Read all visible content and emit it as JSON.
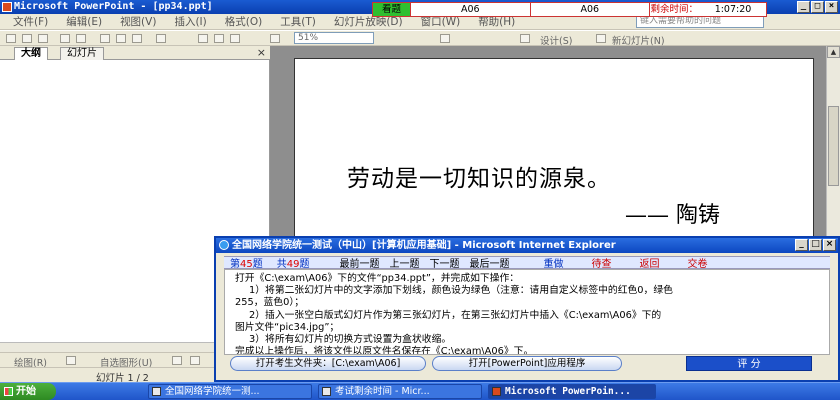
{
  "ppt": {
    "title": "Microsoft PowerPoint - [pp34.ppt]",
    "menu": [
      "文件(F)",
      "编辑(E)",
      "视图(V)",
      "插入(I)",
      "格式(O)",
      "工具(T)",
      "幻灯片放映(D)",
      "窗口(W)",
      "帮助(H)"
    ],
    "help_box": "键入需要帮助的问题",
    "zoom": "51%",
    "toolbar_design": "设计(S)",
    "toolbar_new_slide": "新幻灯片(N)",
    "pane_tabs": [
      "大纲",
      "幻灯片"
    ],
    "pane_close": "×",
    "slide": {
      "line1": "劳动是一切知识的源泉。",
      "line2": "—— 陶铸"
    },
    "draw_label": "绘图(R)",
    "autoshape_label": "自选图形(U)",
    "status": "幻灯片 1 / 2"
  },
  "timer": {
    "view_btn": "看题",
    "cell1": "A06",
    "cell2": "A06",
    "label": "剩余时间：",
    "time": "1:07:20"
  },
  "exam": {
    "title": "全国网络学院统一测试（中山）[计算机应用基础] - Microsoft Internet Explorer",
    "nav": {
      "current_prefix": "第",
      "current_num": "45",
      "current_suffix": "题",
      "total_prefix": "共",
      "total_num": "49",
      "total_suffix": "题",
      "first": "最前一题",
      "prev": "上一题",
      "next": "下一题",
      "last": "最后一题",
      "redo": "重做",
      "review": "待查",
      "back": "返回",
      "submit": "交卷"
    },
    "lines": [
      "打开《C:\\exam\\A06》下的文件“pp34.ppt”，并完成如下操作：",
      "1）将第二张幻灯片中的文字添加下划线，颜色设为绿色（注意：请用自定义标签中的红色0，绿色",
      "255，蓝色0）；",
      "2）插入一张空白版式幻灯片作为第三张幻灯片，在第三张幻灯片中插入《C:\\exam\\A06》下的",
      "图片文件“pic34.jpg”；",
      "3）将所有幻灯片的切换方式设置为盒状收缩。",
      "完成以上操作后，将该文件以原文件名保存在《C:\\exam\\A06》下。"
    ],
    "btn_open_folder": "打开考生文件夹：[C:\\exam\\A06]",
    "btn_open_app": "打开[PowerPoint]应用程序",
    "btn_score": "评 分"
  },
  "taskbar": {
    "start": "开始",
    "tasks": [
      "全国网络学院统一测...",
      "考试剩余时间 - Micr...",
      "Microsoft PowerPoin..."
    ]
  },
  "colors": {
    "titlebar": "#0a3fb0",
    "timer_green": "#2fbf2f",
    "score_btn": "#1b4fc9",
    "taskbar": "#1f55c9"
  }
}
